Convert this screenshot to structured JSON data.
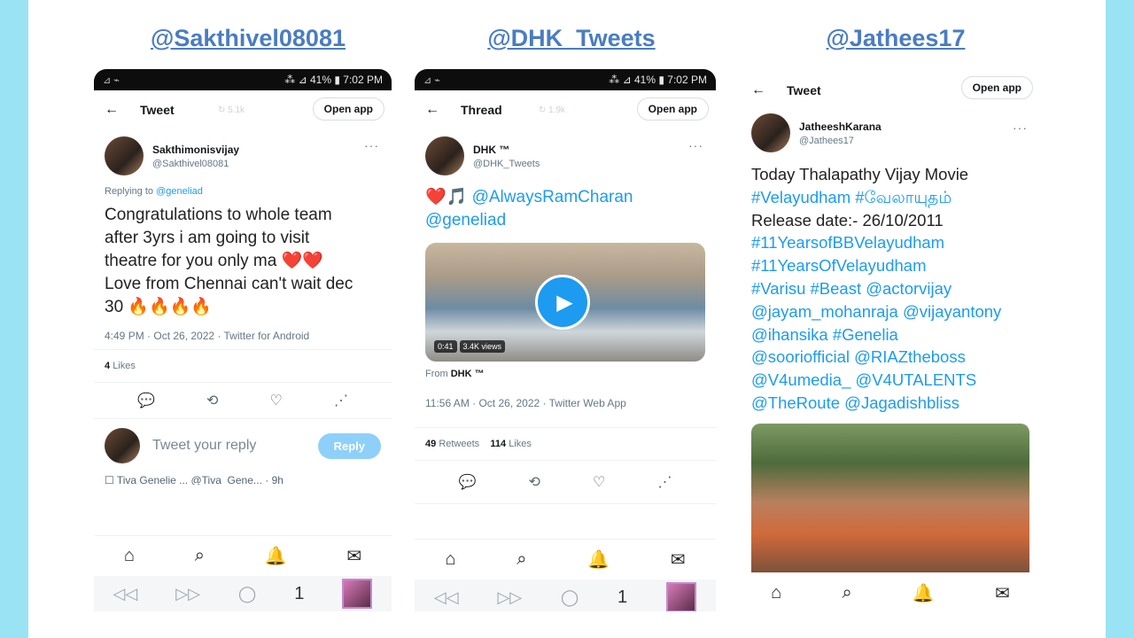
{
  "columns": [
    {
      "handle": "@Sakthivel08081",
      "status": {
        "battery": "41%",
        "time": "7:02 PM"
      },
      "topbar": {
        "back": "←",
        "title": "Tweet",
        "ghost": "↻ 5.1k",
        "open_app": "Open app"
      },
      "user": {
        "name": "Sakthimonisvijay",
        "handle": "@Sakthivel08081"
      },
      "replying": {
        "prefix": "Replying to",
        "target": "@geneliad"
      },
      "text_lines": [
        "Congratulations to whole team",
        "after 3yrs i am going to visit",
        "theatre for you only ma ❤️❤️",
        "Love from Chennai can't wait dec",
        "30 🔥🔥🔥🔥"
      ],
      "meta": "4:49 PM · Oct 26, 2022 · Twitter for Android",
      "likes": {
        "count": "4",
        "label": "Likes"
      },
      "reply_placeholder": "Tweet your reply",
      "reply_button": "Reply",
      "next_row": "☐ Tiva Genelie ... @Tiva_Gene... · 9h",
      "system_nav_number": "1"
    },
    {
      "handle": "@DHK_Tweets",
      "status": {
        "battery": "41%",
        "time": "7:02 PM"
      },
      "topbar": {
        "back": "←",
        "title": "Thread",
        "ghost": "↻ 1.9k",
        "open_app": "Open app"
      },
      "user": {
        "name": "DHK ™",
        "handle": "@DHK_Tweets"
      },
      "text_lines": [
        "❤️🎵 @AlwaysRamCharan",
        "@geneliad"
      ],
      "video": {
        "duration": "0:41",
        "views": "3.4K views"
      },
      "from": {
        "prefix": "From",
        "name": "DHK ™"
      },
      "meta": "11:56 AM · Oct 26, 2022 · Twitter Web App",
      "retweets": {
        "count": "49",
        "label": "Retweets"
      },
      "likes": {
        "count": "114",
        "label": "Likes"
      },
      "system_nav_number": "1"
    },
    {
      "handle": "@Jathees17",
      "topbar": {
        "back": "←",
        "title": "Tweet",
        "open_app": "Open app"
      },
      "user": {
        "name": "JatheeshKarana",
        "handle": "@Jathees17"
      },
      "text_lines": [
        "Today Thalapathy Vijay Movie",
        "#Velayudham #வேலாயுதம்",
        "Release date:- 26/10/2011",
        "#11YearsofBBVelayudham",
        "#11YearsOfVelayudham",
        "#Varisu #Beast @actorvijay",
        "@jayam_mohanraja @vijayantony",
        "@ihansika #Genelia",
        "@sooriofficial @RIAZtheboss",
        "@V4umedia_ @V4UTALENTS",
        "@TheRoute @Jagadishbliss"
      ]
    }
  ],
  "icons": {
    "home": "⌂",
    "search": "⌕",
    "bell": "🔔",
    "mail": "✉",
    "reply": "💬",
    "retweet": "⟲",
    "like": "♡",
    "share": "⋰",
    "back_nav": "◁◁",
    "forward_nav": "▷▷",
    "reload": "◯"
  },
  "colors": {
    "band": "#99e3f5",
    "handle": "#4a7cc2",
    "link": "#1d9bf0",
    "reply_button": "#8ed0fa"
  }
}
